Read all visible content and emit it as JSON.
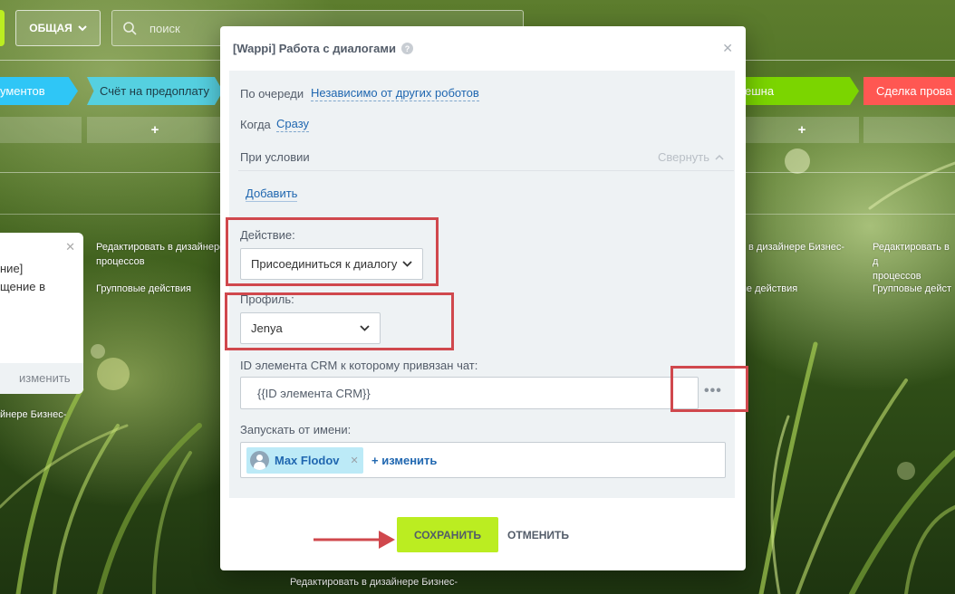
{
  "topbar": {
    "filter_label": "ОБЩАЯ",
    "search_placeholder": "поиск"
  },
  "stages": [
    {
      "label": "ументов",
      "color": "#2fc6f6"
    },
    {
      "label": "Счёт на предоплату",
      "color": "#55d0e0"
    },
    {
      "label": "ешна",
      "color": "#7bd500"
    },
    {
      "label": "Сделка прова",
      "color": "#ff5752"
    }
  ],
  "add_symbol": "+",
  "background_links": {
    "edit_in_designer_1": "Редактировать в дизайнере",
    "processes_1": "процессов",
    "group_actions_1": "Групповые действия",
    "edit_in_designer_2": "в дизайнере Бизнес-",
    "group_actions_2": "ые действия",
    "edit_in_designer_3": "Редактировать в д",
    "processes_3": "процессов",
    "group_actions_3": "Групповые дейст",
    "left_designer": "йнере Бизнес-",
    "bottom_designer": "Редактировать в дизайнере Бизнес-"
  },
  "left_card": {
    "line1": "ние]",
    "line2": "щение в",
    "change": "изменить"
  },
  "dialog": {
    "title": "[Wappi] Работа с диалогами",
    "queue_label": "По очереди",
    "queue_value": "Независимо от других роботов",
    "when_label": "Когда",
    "when_value": "Сразу",
    "condition_label": "При условии",
    "collapse_label": "Свернуть",
    "add_label": "Добавить",
    "action_label": "Действие:",
    "action_value": "Присоединиться к диалогу",
    "profile_label": "Профиль:",
    "profile_value": "Jenya",
    "crm_label": "ID элемента CRM к которому привязан чат:",
    "crm_value": "{{ID элемента CRM}}",
    "run_as_label": "Запускать от имени:",
    "user_name": "Max Flodov",
    "change_label": "изменить",
    "save_label": "СОХРАНИТЬ",
    "cancel_label": "ОТМЕНИТЬ"
  },
  "colors": {
    "highlight": "#d0484d",
    "save_button": "#bbed21",
    "link": "#2067b0"
  }
}
